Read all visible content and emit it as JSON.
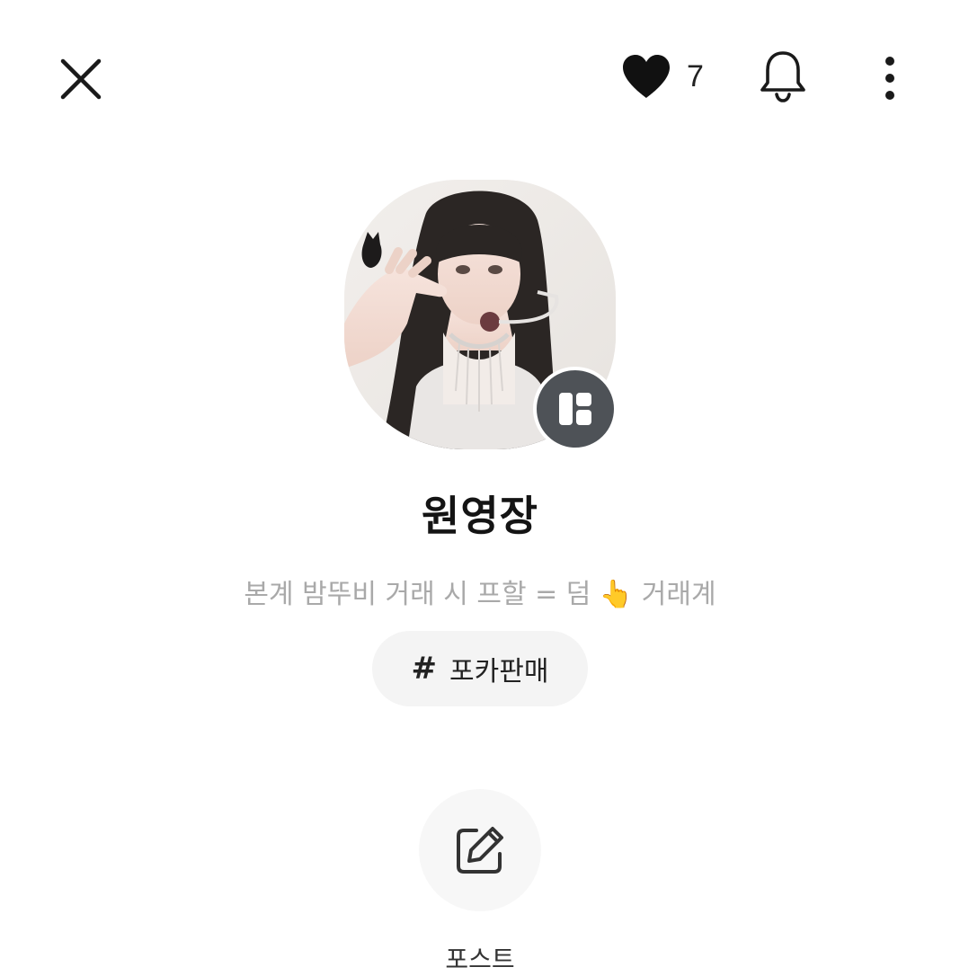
{
  "header": {
    "close_icon": "close-icon",
    "like_icon": "heart-icon",
    "like_count": "7",
    "bell_icon": "bell-icon",
    "more_icon": "more-vertical-icon"
  },
  "profile": {
    "badge_icon": "store-grid-icon",
    "name": "원영장",
    "bio": "본계 밤뚜비 거래 시 프할 = 덤 👆 거래계",
    "tag_symbol": "#",
    "tag": "포카판매"
  },
  "actions": {
    "write_icon": "edit-icon",
    "write_label": "포스트"
  },
  "colors": {
    "text_primary": "#141414",
    "text_secondary": "#a9a9a9",
    "chip_bg": "#f4f4f4",
    "badge_bg": "#4e5257"
  }
}
